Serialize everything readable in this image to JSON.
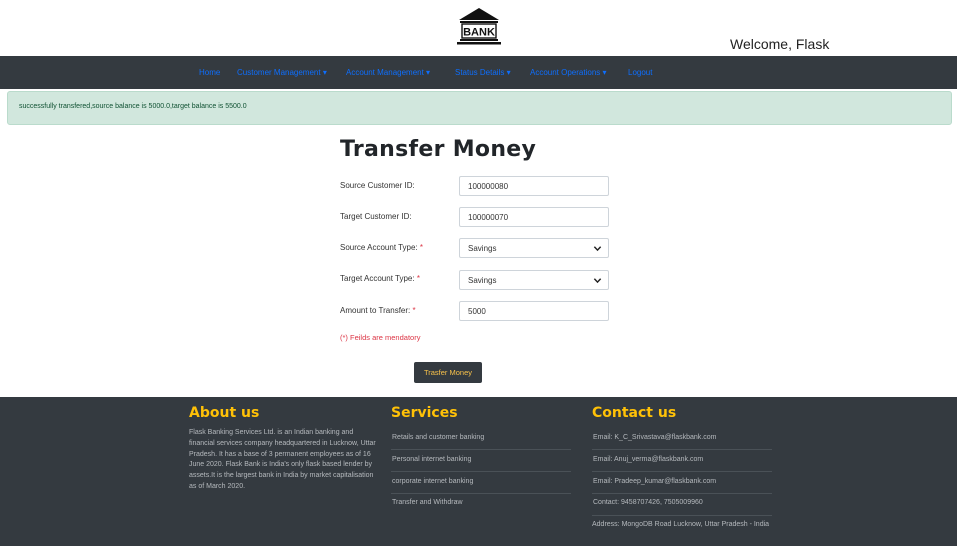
{
  "header": {
    "logo_text": "BANK",
    "welcome": "Welcome, Flask"
  },
  "nav": {
    "items": [
      {
        "label": "Home"
      },
      {
        "label": "Customer Management ▾"
      },
      {
        "label": "Account Management ▾"
      },
      {
        "label": "Status Details ▾"
      },
      {
        "label": "Account Operations ▾"
      },
      {
        "label": "Logout"
      }
    ]
  },
  "alert": {
    "message": "successfully transfered,source balance is 5000.0,target balance is 5500.0"
  },
  "form": {
    "title": "Transfer Money",
    "source_customer": {
      "label": "Source Customer ID:",
      "value": "100000080"
    },
    "target_customer": {
      "label": "Target Customer ID:",
      "value": "100000070"
    },
    "source_account_type": {
      "label": "Source Account Type:",
      "value": "Savings"
    },
    "target_account_type": {
      "label": "Target Account Type:",
      "value": "Savings"
    },
    "amount": {
      "label": "Amount to Transfer:",
      "value": "5000"
    },
    "required_mark": "*",
    "mandatory_note": "(*) Feilds are mendatory",
    "submit_label": "Trasfer Money"
  },
  "footer": {
    "about": {
      "heading": "About us",
      "text": "Flask Banking Services Ltd. is an Indian banking and financial services company headquartered in Lucknow, Uttar Pradesh. It has a base of 3 permanent employees as of 16 June 2020. Flask Bank is India's only flask based lender by assets.It is the largest bank in India by market capitalisation as of March 2020."
    },
    "services": {
      "heading": "Services",
      "items": [
        {
          "label": "Retails and customer banking"
        },
        {
          "label": "Personal internet banking"
        },
        {
          "label": "corporate internet banking"
        },
        {
          "label": "Transfer and Withdraw"
        }
      ]
    },
    "contact": {
      "heading": "Contact us",
      "emails": [
        "Email: K_C_Srivastava@flaskbank.com",
        "Email: Anuj_verma@flaskbank.com",
        "Email: Pradeep_kumar@flaskbank.com"
      ],
      "phone": "Contact: 9458707426, 7505009960",
      "address": "Address: MongoDB Road Lucknow, Uttar Pradesh - India"
    }
  }
}
